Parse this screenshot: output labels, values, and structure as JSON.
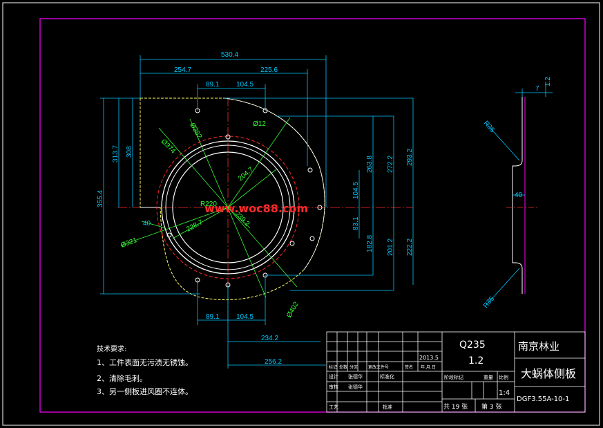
{
  "dimensions": {
    "overall_width": "530.4",
    "left_width": "254.7",
    "right_width": "225.6",
    "top_hole_left": "89.1",
    "top_hole_right": "104.5",
    "bottom_hole_left": "89.1",
    "bottom_hole_right": "104.5",
    "bottom_234": "234.2",
    "bottom_256": "256.2",
    "left_355": "355.4",
    "left_313": "313.7",
    "left_308": "308",
    "right_263": "263.8",
    "right_272": "272.2",
    "right_293": "293.2",
    "right_104": "104.5",
    "right_83": "83.1",
    "right_182": "182.8",
    "right_201": "201.2",
    "right_222": "222.2",
    "small_40": "40",
    "dia_374": "Ø374",
    "dia_382": "Ø382",
    "dia_12": "Ø12",
    "r_204": "204.7",
    "dia_321": "Ø321",
    "r_228": "228.7",
    "r_239": "239.2",
    "dia_402": "Ø402",
    "r_center": "R220"
  },
  "side_view": {
    "dim_7": "7",
    "dim_1_2": "1.2",
    "dim_40": "40",
    "r35_top": "R35",
    "r35_bottom": "R35"
  },
  "watermark": "www.woc88.com",
  "notes": {
    "heading": "技术要求:",
    "item1": "1、工件表面无污渍无锈蚀。",
    "item2": "2、清除毛刺。",
    "item3": "3、另一侧板进风圈不连体。"
  },
  "title_block": {
    "material": "Q235",
    "thickness": "1.2",
    "company": "南京林业",
    "part_name": "大蜗体侧板",
    "date": "2013.5",
    "scale": "1:4",
    "sheets_total": "共 19 张",
    "sheet_no": "第 3 张",
    "drawing_no": "DGF3.55A-10-1",
    "row_labels": [
      "标记",
      "处数",
      "分区",
      "更改文件号",
      "签名",
      "年.月.日"
    ],
    "design": "设计",
    "designer": "张德华",
    "standardization": "标准化",
    "review": "审核",
    "reviewer": "张德华",
    "process": "工艺",
    "approve": "批准",
    "stage_labels": [
      "阶段标记",
      "重量",
      "比例"
    ]
  },
  "colors": {
    "frame": "#ff00ff",
    "dimension": "#00c8ff",
    "green_dim": "#33ff33",
    "outline_yellow": "#ffff66",
    "centerline_red": "#ff2a2a"
  }
}
